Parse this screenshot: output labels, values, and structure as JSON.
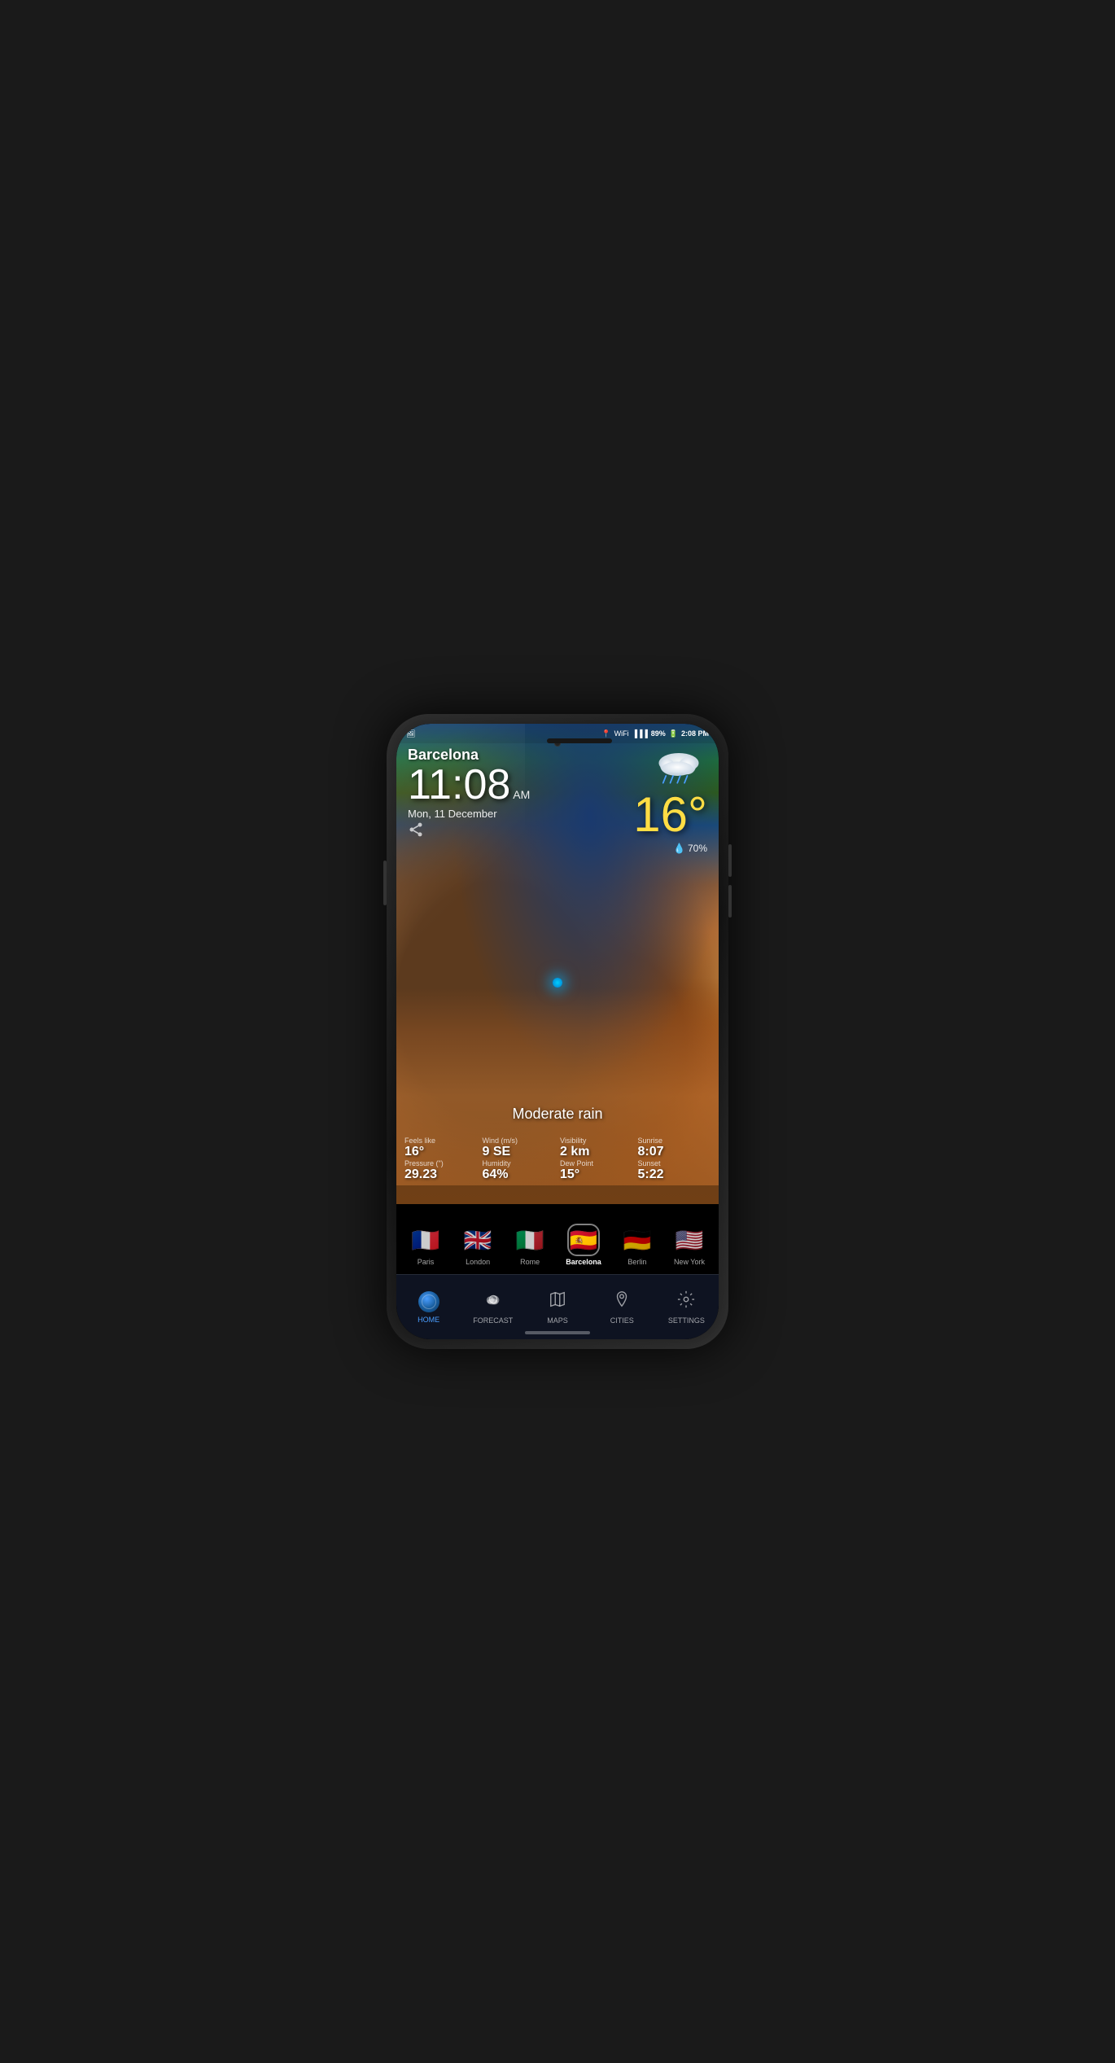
{
  "phone": {
    "status_bar": {
      "battery": "89%",
      "time": "2:08 PM",
      "signal_icon": "📶",
      "wifi_icon": "📡",
      "location_icon": "📍"
    },
    "weather": {
      "city": "Barcelona",
      "time": "11",
      "time_colon": ":",
      "time_minutes": "08",
      "time_ampm": "AM",
      "date": "Mon, 11 December",
      "temperature": "16°",
      "humidity_label": "💧",
      "humidity": "70%",
      "condition": "Moderate rain",
      "feels_like_label": "Feels like",
      "feels_like_value": "16°",
      "wind_label": "Wind (m/s)",
      "wind_value": "9 SE",
      "visibility_label": "Visibility",
      "visibility_value": "2 km",
      "sunrise_label": "Sunrise",
      "sunrise_value": "8:07",
      "pressure_label": "Pressure (\")",
      "pressure_value": "29.23",
      "humidity_stat_label": "Humidity",
      "humidity_stat_value": "64%",
      "dew_point_label": "Dew Point",
      "dew_point_value": "15°",
      "sunset_label": "Sunset",
      "sunset_value": "5:22"
    },
    "cities": [
      {
        "id": "paris",
        "label": "Paris",
        "flag": "🇫🇷",
        "active": false
      },
      {
        "id": "london",
        "label": "London",
        "flag": "🇬🇧",
        "active": false
      },
      {
        "id": "rome",
        "label": "Rome",
        "flag": "🇮🇹",
        "active": false
      },
      {
        "id": "barcelona",
        "label": "Barcelona",
        "flag": "🇪🇸",
        "active": true
      },
      {
        "id": "berlin",
        "label": "Berlin",
        "flag": "🇩🇪",
        "active": false
      },
      {
        "id": "newyork",
        "label": "New York",
        "flag": "🇺🇸",
        "active": false
      }
    ],
    "nav": [
      {
        "id": "home",
        "label": "HOME",
        "icon": "globe",
        "active": true
      },
      {
        "id": "forecast",
        "label": "FORECAST",
        "icon": "⛅",
        "active": false
      },
      {
        "id": "maps",
        "label": "MAPS",
        "icon": "🗺",
        "active": false
      },
      {
        "id": "cities",
        "label": "CITIES",
        "icon": "📍",
        "active": false
      },
      {
        "id": "settings",
        "label": "SETTINGS",
        "icon": "⚙",
        "active": false
      }
    ]
  }
}
